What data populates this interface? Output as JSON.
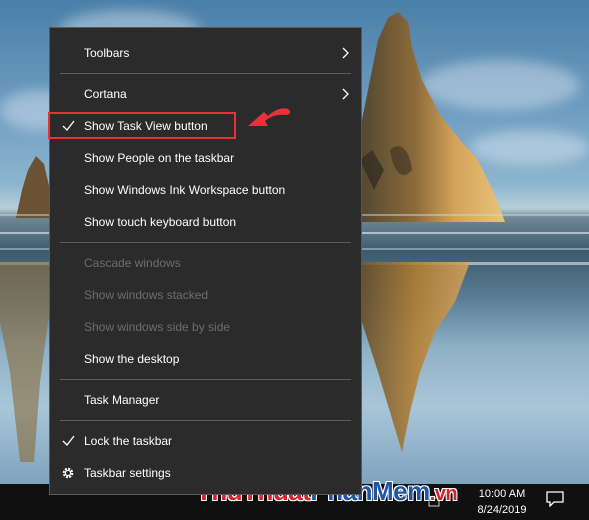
{
  "menu": {
    "items": [
      {
        "label": "Toolbars",
        "submenu": true,
        "checked": false,
        "disabled": false
      },
      {
        "label": "Cortana",
        "submenu": true,
        "checked": false,
        "disabled": false
      },
      {
        "label": "Show Task View button",
        "submenu": false,
        "checked": true,
        "disabled": false
      },
      {
        "label": "Show People on the taskbar",
        "submenu": false,
        "checked": false,
        "disabled": false
      },
      {
        "label": "Show Windows Ink Workspace button",
        "submenu": false,
        "checked": false,
        "disabled": false
      },
      {
        "label": "Show touch keyboard button",
        "submenu": false,
        "checked": false,
        "disabled": false
      },
      {
        "label": "Cascade windows",
        "submenu": false,
        "checked": false,
        "disabled": true
      },
      {
        "label": "Show windows stacked",
        "submenu": false,
        "checked": false,
        "disabled": true
      },
      {
        "label": "Show windows side by side",
        "submenu": false,
        "checked": false,
        "disabled": true
      },
      {
        "label": "Show the desktop",
        "submenu": false,
        "checked": false,
        "disabled": false
      },
      {
        "label": "Task Manager",
        "submenu": false,
        "checked": false,
        "disabled": false
      },
      {
        "label": "Lock the taskbar",
        "submenu": false,
        "checked": true,
        "disabled": false
      },
      {
        "label": "Taskbar settings",
        "submenu": false,
        "checked": false,
        "disabled": false,
        "icon": "gear-icon"
      }
    ]
  },
  "annotation": {
    "highlight_color": "#e8313b",
    "arrow_icon": "red-pointer-arrow-icon"
  },
  "tray": {
    "time": "10:00 AM",
    "date": "8/24/2019",
    "notification_icon": "action-center-icon"
  },
  "watermark": {
    "part1": "Thu",
    "part2": "Thuat",
    "part3": "Phan",
    "part4": "Mem",
    "part5": ".vn"
  },
  "colors": {
    "menu_bg": "#2b2b2b",
    "menu_text": "#ffffff",
    "menu_disabled_text": "#6d6d6d",
    "taskbar_bg": "#101010"
  }
}
